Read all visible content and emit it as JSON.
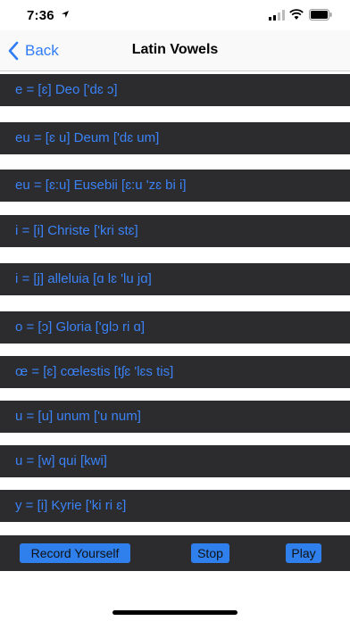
{
  "status": {
    "time": "7:36"
  },
  "nav": {
    "back_label": "Back",
    "title": "Latin Vowels"
  },
  "rows": [
    "e = [ɛ] Deo ['dɛ ɔ]",
    "eu = [ɛ u] Deum ['dɛ um]",
    "eu = [ɛ:u] Eusebii [ɛ:u 'zɛ bi i]",
    "i = [i] Christe ['kri stɛ]",
    "i = [j] alleluia [ɑ lɛ 'lu jɑ]",
    "o = [ɔ] Gloria ['glɔ ri ɑ]",
    "œ = [ɛ] cœlestis [tʃɛ 'lɛs tis]",
    "u = [u] unum ['u num]",
    "u = [w] qui [kwi]",
    "y = [i] Kyrie ['ki ri ɛ]"
  ],
  "toolbar": {
    "record_label": "Record Yourself",
    "stop_label": "Stop",
    "play_label": "Play"
  },
  "colors": {
    "accent": "#2f7cf6",
    "row_bg": "#2c2c2e",
    "row_text": "#3b82f6",
    "button_bg": "#2f80ed"
  }
}
